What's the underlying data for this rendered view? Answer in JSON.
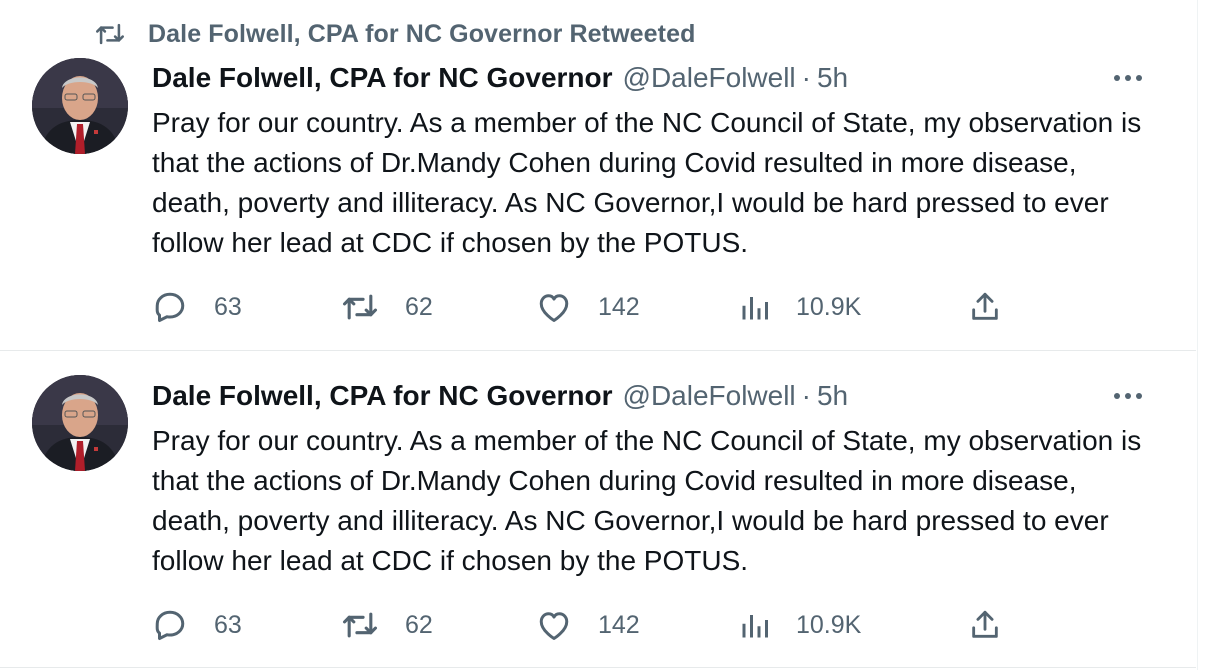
{
  "retweet_context": {
    "label": "Dale Folwell, CPA for NC Governor Retweeted",
    "icon": "retweet-icon"
  },
  "tweets": [
    {
      "author_name": "Dale Folwell, CPA for NC Governor",
      "handle": "@DaleFolwell",
      "separator": "·",
      "time": "5h",
      "text": "Pray for our country. As a member of the NC Council of State, my observation is that the actions of Dr.Mandy Cohen during Covid resulted in more disease, death, poverty and illiteracy. As NC Governor,I would be hard pressed to ever follow her lead at CDC if chosen by the  POTUS.",
      "stats": {
        "replies": "63",
        "retweets": "62",
        "likes": "142",
        "views": "10.9K"
      }
    },
    {
      "author_name": "Dale Folwell, CPA for NC Governor",
      "handle": "@DaleFolwell",
      "separator": "·",
      "time": "5h",
      "text": "Pray for our country. As a member of the NC Council of State, my observation is that the actions of Dr.Mandy Cohen during Covid resulted in more disease, death, poverty and illiteracy. As NC Governor,I would be hard pressed to ever follow her lead at CDC if chosen by the  POTUS.",
      "stats": {
        "replies": "63",
        "retweets": "62",
        "likes": "142",
        "views": "10.9K"
      }
    }
  ],
  "colors": {
    "text_primary": "#0f1419",
    "text_secondary": "#536471",
    "divider": "#e7eaeb"
  },
  "icons": [
    "retweet-icon",
    "more-icon",
    "reply-icon",
    "like-icon",
    "views-icon",
    "share-icon"
  ]
}
